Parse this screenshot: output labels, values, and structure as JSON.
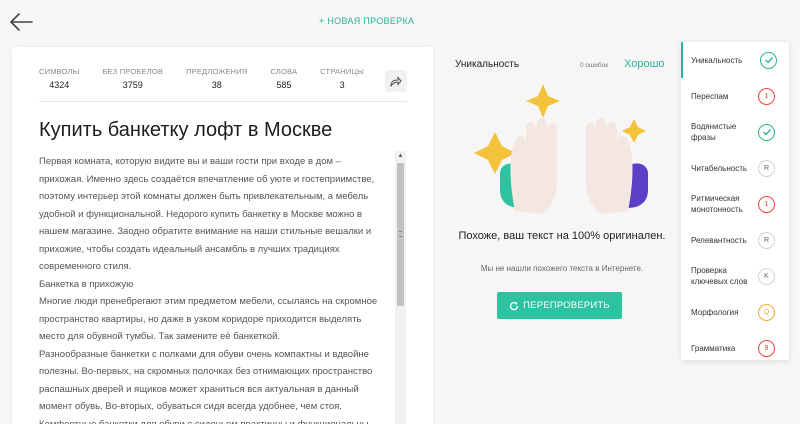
{
  "header": {
    "back_icon": "arrow-left-icon",
    "new_check_label": "+ НОВАЯ ПРОВЕРКА"
  },
  "stats": [
    {
      "label": "СИМВОЛЫ",
      "value": "4324"
    },
    {
      "label": "БЕЗ ПРОБЕЛОВ",
      "value": "3759"
    },
    {
      "label": "ПРЕДЛОЖЕНИЯ",
      "value": "38"
    },
    {
      "label": "СЛОВА",
      "value": "585"
    },
    {
      "label": "СТРАНИЦЫ",
      "value": "3"
    }
  ],
  "share_icon": "share-icon",
  "document": {
    "title": "Купить банкетку лофт в Москве",
    "body": "Первая комната, которую видите вы и ваши гости при входе в дом – прихожая. Именно здесь создаётся впечатление об уюте и гостеприимстве, поэтому интерьер этой комнаты должен быть привлекательным, а мебель удобной и функциональной. Недорого купить банкетку в Москве можно в нашем магазине. Заодно обратите внимание на наши стильные вешалки и прихожие, чтобы создать идеальный ансамбль в лучших традициях современного стиля.\nБанкетка в прихожую\nМногие люди пренебрегают этим предметом мебели, ссылаясь на скромное пространство квартиры, но даже в узком коридоре приходится выделять место для обувной тумбы. Так замените её банкеткой.\nРазнообразные банкетки с полками для обуви очень компактны и вдвойне полезны. Во-первых, на скромных полочках без отнимающих пространство распашных дверей и ящиков может храниться вся актуальная в данный момент обувь. Во-вторых, обуваться сидя всегда удобнее, чем стоя.\nКомфортные банкетки для обуви с сиденьем практичны и функциональны."
  },
  "result": {
    "heading": "Уникальность",
    "errors": "0 ошибок",
    "grade": "Хорошо",
    "message": "Похоже, ваш текст на 100% оригинален.",
    "sub_message": "Мы не нашли похожего текста в Интернете.",
    "recheck_label": "ПЕРЕПРОВЕРИТЬ",
    "colors": {
      "accent": "#2ec3a0",
      "red": "#e8473b",
      "orange": "#f2a93b",
      "purple": "#5b3fc4",
      "star": "#f3c33c"
    }
  },
  "checks": [
    {
      "label": "Уникальность",
      "badge": "",
      "kind": "check",
      "icon": "check-circle-icon"
    },
    {
      "label": "Переспам",
      "badge": "1",
      "kind": "red"
    },
    {
      "label": "Водянистые фразы",
      "badge": "",
      "kind": "check",
      "icon": "check-circle-icon"
    },
    {
      "label": "Читабельность",
      "badge": "R",
      "kind": "gray"
    },
    {
      "label": "Ритмическая монотонность",
      "badge": "1",
      "kind": "red"
    },
    {
      "label": "Релевантность",
      "badge": "R",
      "kind": "gray"
    },
    {
      "label": "Проверка ключевых слов",
      "badge": "K",
      "kind": "gray"
    },
    {
      "label": "Морфология",
      "badge": "Q",
      "kind": "orange"
    },
    {
      "label": "Грамматика",
      "badge": "9",
      "kind": "red"
    }
  ]
}
